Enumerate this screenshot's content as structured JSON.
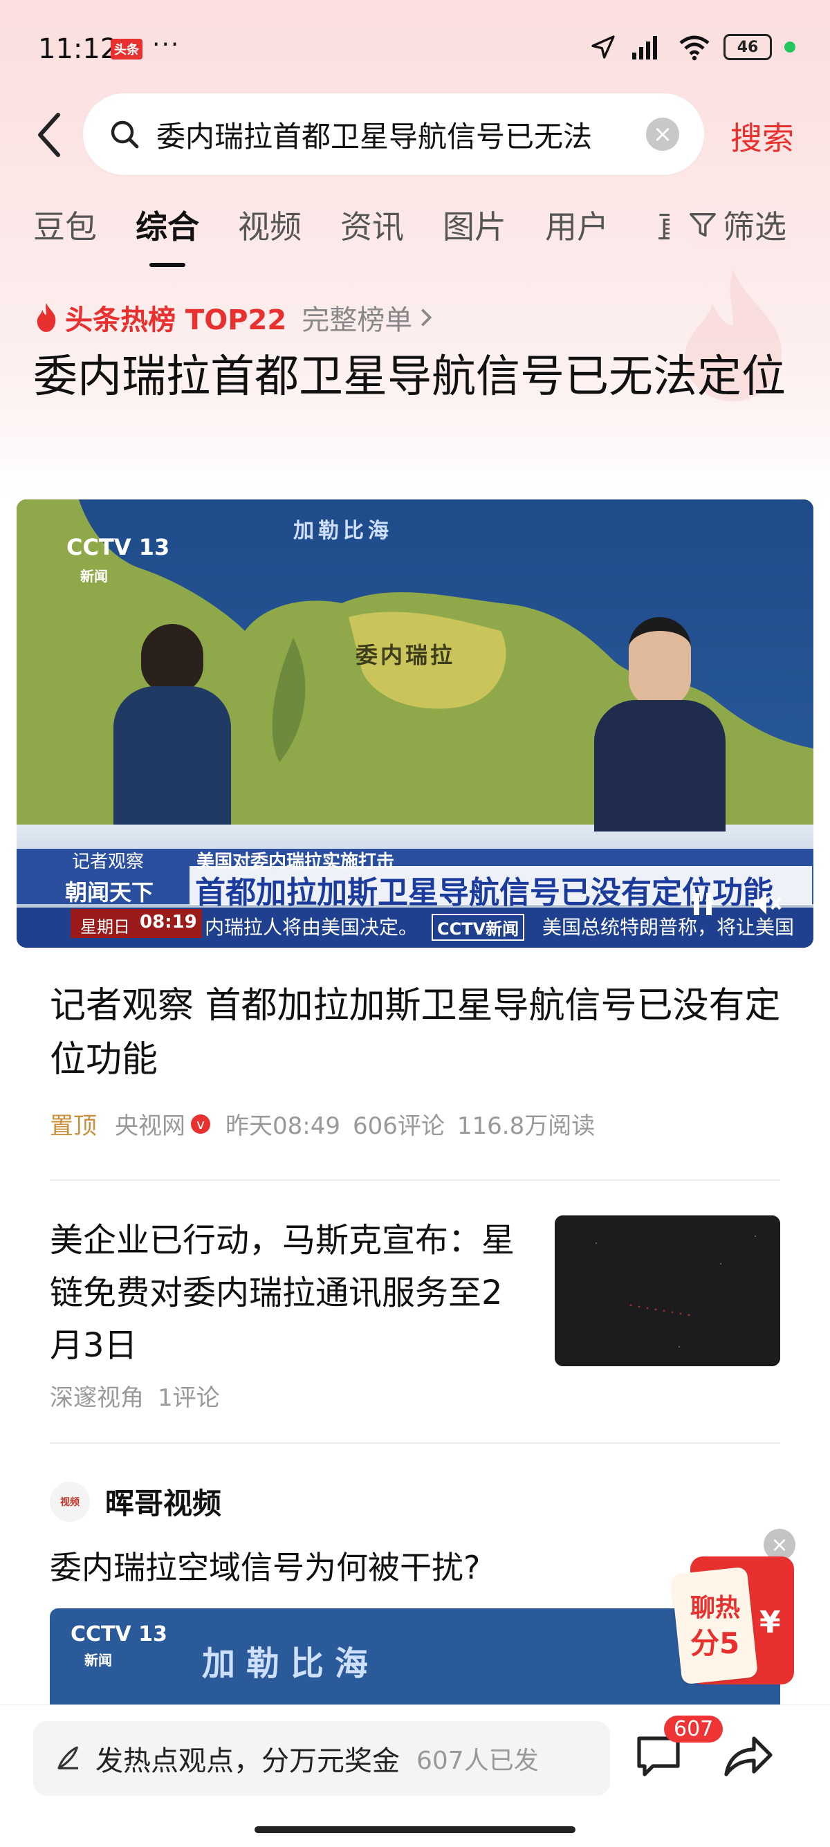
{
  "status": {
    "time": "11:12",
    "app_badge": "头条",
    "dots": "···",
    "battery": "46"
  },
  "search": {
    "query": "委内瑞拉首都卫星导航信号已无法",
    "button": "搜索"
  },
  "tabs": [
    "豆包",
    "综合",
    "视频",
    "资讯",
    "图片",
    "用户"
  ],
  "tab_cut": "直",
  "filter_label": "筛选",
  "hot": {
    "label": "头条热榜 TOP22",
    "link": "完整榜单",
    "title": "委内瑞拉首都卫星导航信号已无法定位"
  },
  "video": {
    "channel": "CCTV 13",
    "channel_sub": "新闻",
    "map_sea": "加勒比海",
    "map_country": "委内瑞拉",
    "tag1": "记者观察",
    "tag2": "美国对委内瑞拉实施打击",
    "program": "朝闻天下",
    "headline": "首都加拉加斯卫星导航信号已没有定位功能",
    "day": "星期日",
    "clock": "08:19",
    "ticker": "内瑞拉人将由美国决定。",
    "ticker_logo": "CCTV新闻",
    "ticker2": "美国总统特朗普称，将让美国"
  },
  "article1": {
    "title": "记者观察 首都加拉加斯卫星导航信号已没有定位功能",
    "pin": "置顶",
    "source": "央视网",
    "time": "昨天08:49",
    "comments": "606评论",
    "reads": "116.8万阅读"
  },
  "article2": {
    "title": "美企业已行动，马斯克宣布：星链免费对委内瑞拉通讯服务至2月3日",
    "source": "深邃视角",
    "comments": "1评论"
  },
  "article3": {
    "account": "晖哥视频",
    "title": "委内瑞拉空域信号为何被干扰?",
    "channel": "CCTV 13",
    "channel_sub": "新闻",
    "map_sea": "加勒比海"
  },
  "promo": {
    "line1": "聊热",
    "line2": "分5",
    "currency": "¥"
  },
  "bottom": {
    "prompt": "发热点观点，分万元奖金",
    "count": "607人已发",
    "badge": "607"
  }
}
